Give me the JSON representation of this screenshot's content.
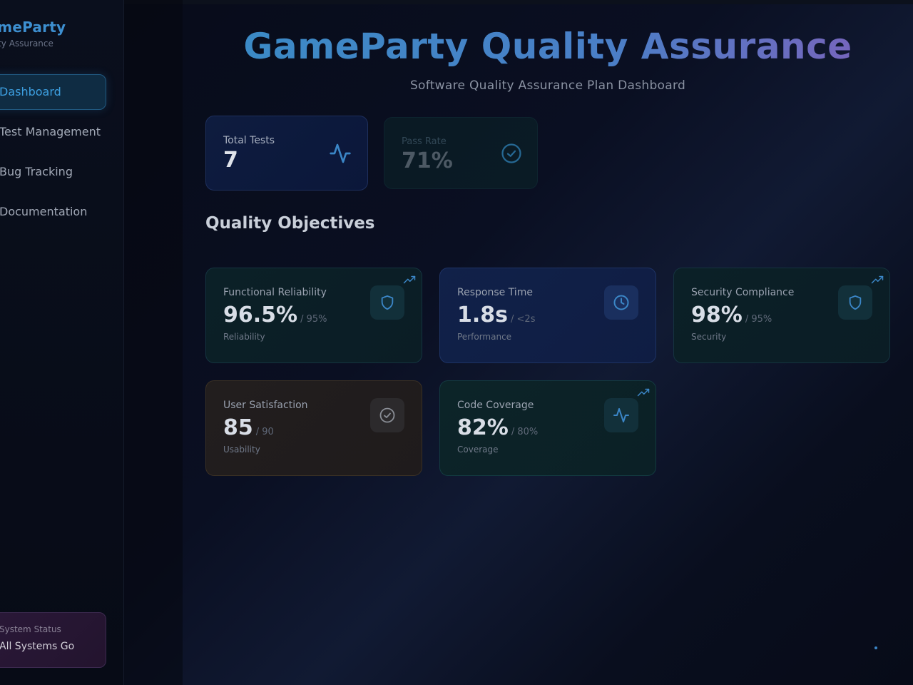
{
  "sidebar": {
    "brand_title": "GameParty",
    "brand_subtitle": "Quality Assurance",
    "nav": [
      {
        "label": "Dashboard",
        "icon": "dashboard-icon",
        "active": true
      },
      {
        "label": "Test Management",
        "icon": "test-icon",
        "active": false
      },
      {
        "label": "Bug Tracking",
        "icon": "bug-icon",
        "active": false
      },
      {
        "label": "Documentation",
        "icon": "document-icon",
        "active": false
      }
    ],
    "status": {
      "label": "System Status",
      "value": "All Systems Go"
    }
  },
  "header": {
    "title": "GameParty Quality Assurance",
    "subtitle": "Software Quality Assurance Plan Dashboard"
  },
  "stats": [
    {
      "label": "Total Tests",
      "value": "7",
      "icon": "activity-icon"
    },
    {
      "label": "Pass Rate",
      "value": "71%",
      "icon": "check-circle-icon"
    }
  ],
  "section_title": "Quality Objectives",
  "objectives": [
    {
      "label": "Functional Reliability",
      "value": "96.5%",
      "target": "/ 95%",
      "category": "Reliability",
      "icon": "shield-icon",
      "trend": true
    },
    {
      "label": "Response Time",
      "value": "1.8s",
      "target": "/ <2s",
      "category": "Performance",
      "icon": "clock-icon",
      "trend": false
    },
    {
      "label": "Security Compliance",
      "value": "98%",
      "target": "/ 95%",
      "category": "Security",
      "icon": "shield-icon",
      "trend": true
    },
    {
      "label": "User Satisfaction",
      "value": "85",
      "target": "/ 90",
      "category": "Usability",
      "icon": "check-circle-icon",
      "trend": false
    },
    {
      "label": "Code Coverage",
      "value": "82%",
      "target": "/ 80%",
      "category": "Coverage",
      "icon": "activity-icon",
      "trend": true
    }
  ],
  "colors": {
    "accent": "#3d8fd0",
    "icon_blue": "#3b86c7",
    "icon_grey": "#8a8e96"
  }
}
